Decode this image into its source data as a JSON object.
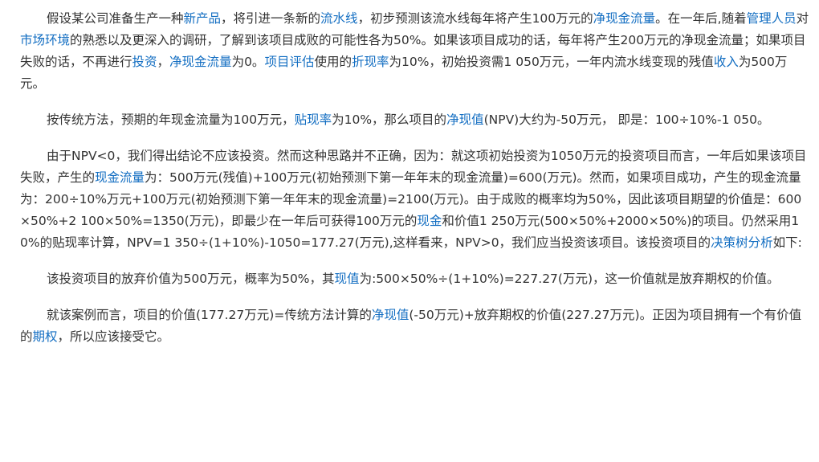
{
  "paragraphs": [
    [
      {
        "t": "假设某公司准备生产一种"
      },
      {
        "t": "新产品",
        "link": true
      },
      {
        "t": "，将引进一条新的"
      },
      {
        "t": "流水线",
        "link": true
      },
      {
        "t": "，初步预测该流水线每年将产生100万元的"
      },
      {
        "t": "净现金流量",
        "link": true
      },
      {
        "t": "。在一年后,随着"
      },
      {
        "t": "管理人员",
        "link": true
      },
      {
        "t": "对"
      },
      {
        "t": "市场环境",
        "link": true
      },
      {
        "t": "的熟悉以及更深入的调研，了解到该项目成败的可能性各为50%。如果该项目成功的话，每年将产生200万元的净现金流量；如果项目失败的话，不再进行"
      },
      {
        "t": "投资",
        "link": true
      },
      {
        "t": "，"
      },
      {
        "t": "净现金流量",
        "link": true
      },
      {
        "t": "为0。"
      },
      {
        "t": "项目评估",
        "link": true
      },
      {
        "t": "使用的"
      },
      {
        "t": "折现率",
        "link": true
      },
      {
        "t": "为10%，初始投资需1 050万元，一年内流水线变现的残值"
      },
      {
        "t": "收入",
        "link": true
      },
      {
        "t": "为500万元。"
      }
    ],
    [
      {
        "t": "按传统方法，预期的年现金流量为100万元，"
      },
      {
        "t": "贴现率",
        "link": true
      },
      {
        "t": "为10%，那么项目的"
      },
      {
        "t": "净现值",
        "link": true
      },
      {
        "t": "(NPV)大约为-50万元， 即是：100÷10%-1 050。"
      }
    ],
    [
      {
        "t": "由于NPV<0，我们得出结论不应该投资。然而这种思路并不正确，因为：就这项初始投资为1050万元的投资项目而言，一年后如果该项目失败，产生的"
      },
      {
        "t": "现金流量",
        "link": true
      },
      {
        "t": "为：500万元(残值)+100万元(初始预测下第一年年末的现金流量)=600(万元)。然而，如果项目成功，产生的现金流量为：200÷10%万元+100万元(初始预测下第一年年末的现金流量)=2100(万元)。由于成败的概率均为50%，因此该项目期望的价值是：600×50%+2 100×50%=1350(万元)，即最少在一年后可获得100万元的"
      },
      {
        "t": "现金",
        "link": true
      },
      {
        "t": "和价值1 250万元(500×50%+2000×50%)的项目。仍然采用10%的贴现率计算，NPV=1 350÷(1+10%)-1050=177.27(万元),这样看来，NPV>0，我们应当投资该项目。该投资项目的"
      },
      {
        "t": "决策树分析",
        "link": true
      },
      {
        "t": "如下:"
      }
    ],
    [
      {
        "t": "该投资项目的放弃价值为500万元，概率为50%，其"
      },
      {
        "t": "现值",
        "link": true
      },
      {
        "t": "为:500×50%÷(1+10%)=227.27(万元)，这一价值就是放弃期权的价值。"
      }
    ],
    [
      {
        "t": "就该案例而言，项目的价值(177.27万元)=传统方法计算的"
      },
      {
        "t": "净现值",
        "link": true
      },
      {
        "t": "(-50万元)+放弃期权的价值(227.27万元)。正因为项目拥有一个有价值的"
      },
      {
        "t": "期权",
        "link": true
      },
      {
        "t": "，所以应该接受它。"
      }
    ]
  ],
  "colors": {
    "text": "#333333",
    "link": "#136ec2"
  }
}
